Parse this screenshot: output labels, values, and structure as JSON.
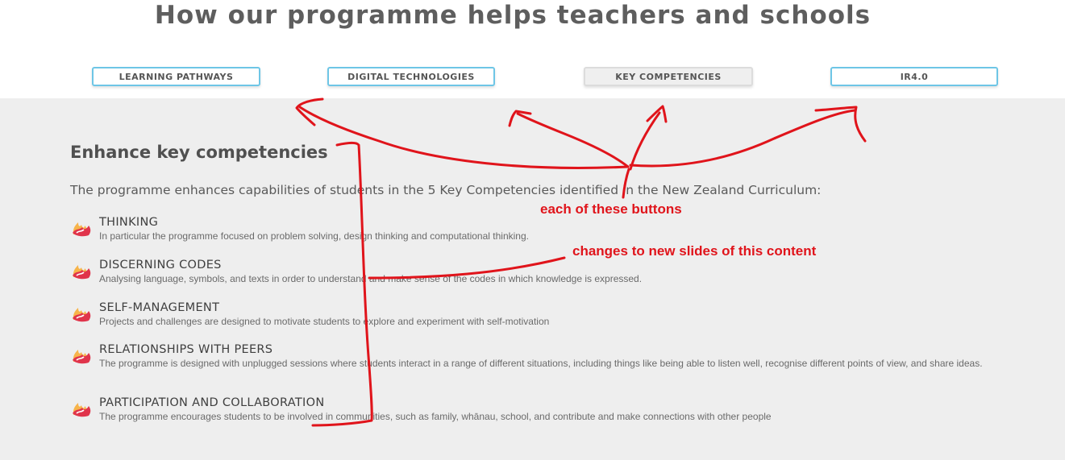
{
  "page_title": "How our programme helps teachers and schools",
  "tabs": [
    {
      "label": "LEARNING PATHWAYS",
      "active": false
    },
    {
      "label": "DIGITAL TECHNOLOGIES",
      "active": false
    },
    {
      "label": "KEY COMPETENCIES",
      "active": true
    },
    {
      "label": "IR4.0",
      "active": false
    }
  ],
  "content": {
    "title": "Enhance key competencies",
    "intro": "The programme enhances capabilities of students in the 5 Key Competencies identified in the New Zealand Curriculum:",
    "items": [
      {
        "title": "THINKING",
        "desc": "In particular the programme focused on problem solving, design thinking and computational thinking."
      },
      {
        "title": "DISCERNING CODES",
        "desc": "Analysing language, symbols, and texts in order to understand and make sense of the codes in which knowledge is expressed."
      },
      {
        "title": "SELF-MANAGEMENT",
        "desc": "Projects and challenges are designed to motivate students to explore and experiment with self-motivation"
      },
      {
        "title": "RELATIONSHIPS WITH PEERS",
        "desc": "The programme is designed with unplugged sessions where students interact in a range of different situations, including things like being able to listen well, recognise different points of view, and share ideas."
      },
      {
        "title": "PARTICIPATION AND COLLABORATION",
        "desc": "The programme encourages students to be involved in communities, such as family, whānau, school, and contribute and make connections with other people"
      }
    ]
  },
  "annotations": {
    "note1": "each of these buttons",
    "note2": "changes to new slides of this content"
  },
  "colors": {
    "tab_border": "#6ec6e6",
    "panel_bg": "#eeeeee",
    "annotation": "#e0141b",
    "icon_primary": "#e0344b",
    "icon_accent": "#f7b44a"
  }
}
